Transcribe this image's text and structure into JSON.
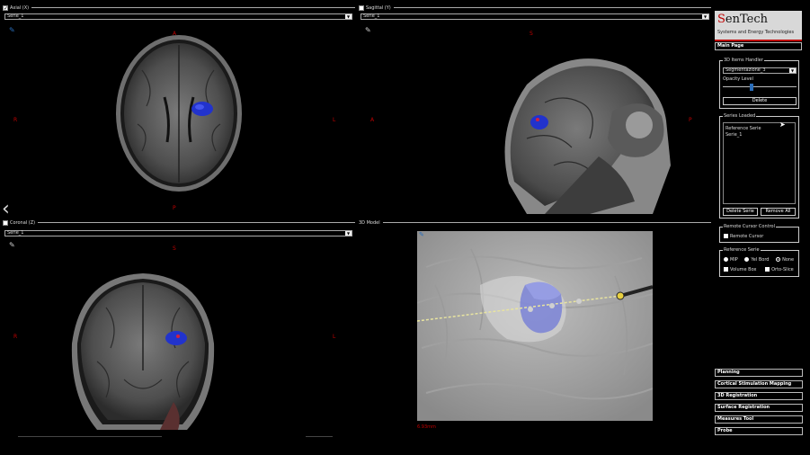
{
  "axial": {
    "title": "Axial (X)",
    "serie": "Serie_1",
    "orient": {
      "top": "A",
      "left": "R",
      "right": "L",
      "bottom": "P"
    }
  },
  "sagittal": {
    "title": "Sagittal (Y)",
    "serie": "Serie_1",
    "orient": {
      "top": "S",
      "left": "A",
      "right": "P"
    }
  },
  "coronal": {
    "title": "Coronal (Z)",
    "serie": "Serie_1",
    "orient": {
      "top": "S",
      "left": "R",
      "right": "L"
    }
  },
  "model3d": {
    "title": "3D Model",
    "distance": "6.93mm"
  },
  "logo": {
    "brand_first": "S",
    "brand_rest": "enTech",
    "subtitle": "Systems and Energy Technologies"
  },
  "panel": {
    "main_page": "Main Page",
    "items_handler": {
      "label": "3D Items Handler",
      "selected": "Segmentazione_3",
      "opacity_label": "Opacity Level",
      "opacity_value": 0.25,
      "delete": "Delete"
    },
    "series_loaded": {
      "label": "Series Loaded",
      "items": [
        "Reference Serie",
        "Serie_1"
      ],
      "delete_serie": "Delete Serie",
      "remove_all": "Remove All"
    },
    "remote_cursor": {
      "label": "Remote Cursor Control",
      "option": "Remote Cursor"
    },
    "reference_serie": {
      "label": "Reference Serie",
      "radios": [
        "MIP",
        "Yel Bord",
        "None"
      ],
      "checks": [
        "Volume Box",
        "Orto-Slice"
      ]
    },
    "nav": [
      "Planning",
      "Cortical Stimulation Mapping",
      "3D Registration",
      "Surface Registration",
      "Measures Tool",
      "Probe"
    ]
  },
  "colors": {
    "accent_red": "#c00000",
    "tumor_blue": "#2233cc",
    "tool_blue": "#2a6ebb"
  }
}
